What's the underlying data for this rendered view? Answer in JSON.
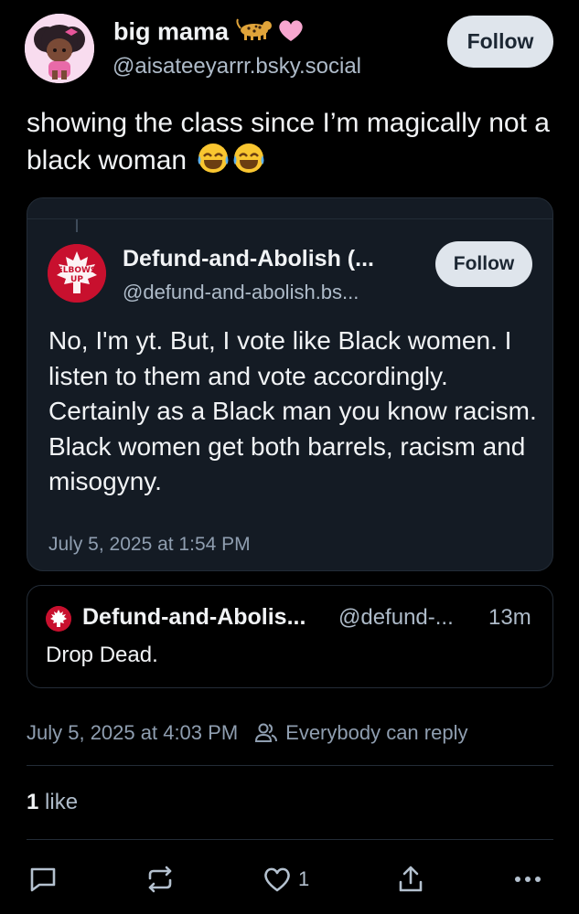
{
  "post": {
    "author_name": "big mama",
    "author_emoji": "🐆🩷",
    "author_handle": "@aisateeyarrr.bsky.social",
    "follow_label": "Follow",
    "text": "showing the class since I’m magically not a black woman",
    "text_emoji": "😂😂"
  },
  "quote": {
    "author_name": "Defund-and-Abolish (...",
    "author_handle": "@defund-and-abolish.bs...",
    "follow_label": "Follow",
    "avatar_text": "ELBOWS UP",
    "body": "No, I'm yt. But, I vote like Black women. I listen to them and vote accordingly. Certainly as a Black man you know racism. Black women get both barrels, racism and misogyny.",
    "timestamp": "July 5, 2025 at 1:54 PM"
  },
  "reply": {
    "author_name": "Defund-and-Abolis...",
    "author_handle": "@defund-...",
    "age": "13m",
    "text": "Drop Dead."
  },
  "meta": {
    "timestamp": "July 5, 2025 at 4:03 PM",
    "reply_policy": "Everybody can reply",
    "reply_policy_icon": "people-icon"
  },
  "likes": {
    "count": "1",
    "label": "like"
  },
  "actions": {
    "reply_icon": "comment-icon",
    "repost_icon": "repost-icon",
    "like_icon": "heart-icon",
    "like_count": "1",
    "share_icon": "share-icon",
    "more_icon": "more-icon"
  },
  "colors": {
    "background": "#000000",
    "card": "#141b24",
    "border": "#232c37",
    "button": "#dfe5ec",
    "muted_text": "#8f9eb0"
  }
}
